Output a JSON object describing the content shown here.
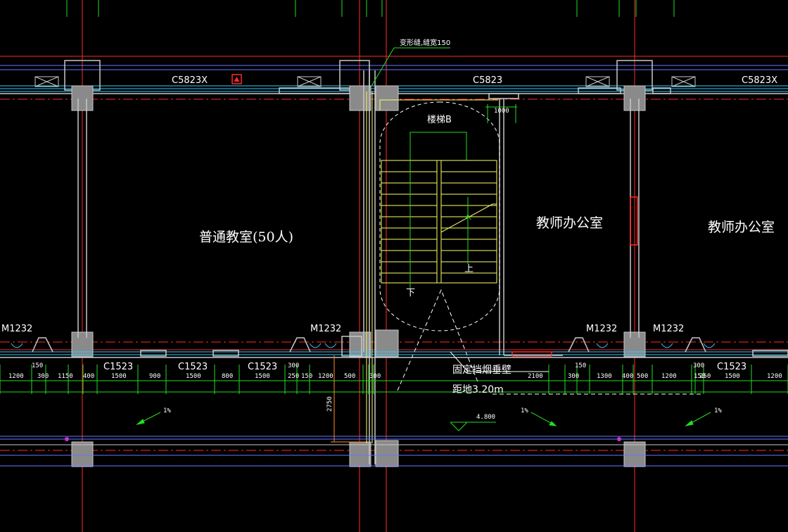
{
  "windows_top": [
    "C5823Ⅹ",
    "C5823",
    "C5823Ⅹ"
  ],
  "rooms": {
    "classroom": "普通教室(50人)",
    "office_1": "教师办公室",
    "office_2": "教师办公室",
    "stair": "楼梯B"
  },
  "stair_marks": {
    "down": "下",
    "up": "上"
  },
  "doors": [
    "M1232",
    "M1232",
    "M1232",
    "M1232"
  ],
  "windows_bottom": [
    "C1523",
    "C1523",
    "C1523",
    "C1523"
  ],
  "notes": {
    "deform_joint": "变形缝,缝宽150",
    "smoke_wall": "固定挡烟垂壁",
    "smoke_height": "距地3.20m",
    "stair_width": "1000"
  },
  "dims_bottom": [
    "150",
    "1200",
    "300",
    "1150",
    "400",
    "1500",
    "900",
    "1500",
    "800",
    "1500",
    "300",
    "250",
    "150",
    "1200",
    "500",
    "300",
    "2100",
    "150",
    "300",
    "1300",
    "400",
    "500",
    "1200",
    "300",
    "150",
    "250",
    "1500",
    "1200"
  ],
  "dim_vertical": "2750",
  "slopes": [
    "1%",
    "1%",
    "1%"
  ],
  "elevation": "4.800",
  "colors": {
    "background": "#000000",
    "axis": "#ff2a2a",
    "wall": "#c8c8c8",
    "stair": "#ffff66",
    "dim": "#22dd22",
    "glass": "#33ccff"
  }
}
